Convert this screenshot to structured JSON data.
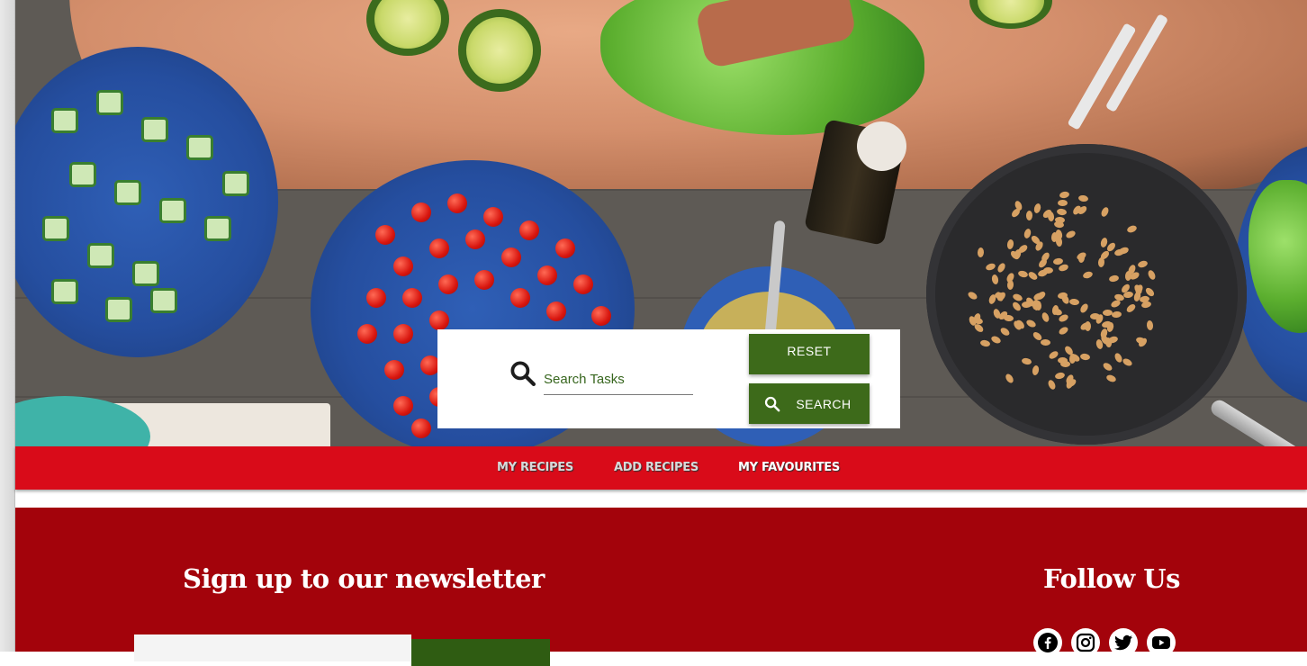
{
  "search": {
    "placeholder": "Search Tasks",
    "reset_label": "RESET",
    "search_label": "SEARCH",
    "icon": "search-icon"
  },
  "nav": {
    "items": [
      {
        "label": "MY RECIPES",
        "active": false
      },
      {
        "label": "ADD RECIPES",
        "active": false
      },
      {
        "label": "MY FAVOURITES",
        "active": true
      }
    ]
  },
  "footer": {
    "newsletter_title": "Sign up to our newsletter",
    "follow_title": "Follow Us",
    "social_icons": [
      "facebook-icon",
      "instagram-icon",
      "twitter-icon",
      "youtube-icon"
    ]
  },
  "colors": {
    "nav_bg": "#d90b19",
    "footer_bg": "#a3030b",
    "button_green": "#3d6a1a"
  }
}
